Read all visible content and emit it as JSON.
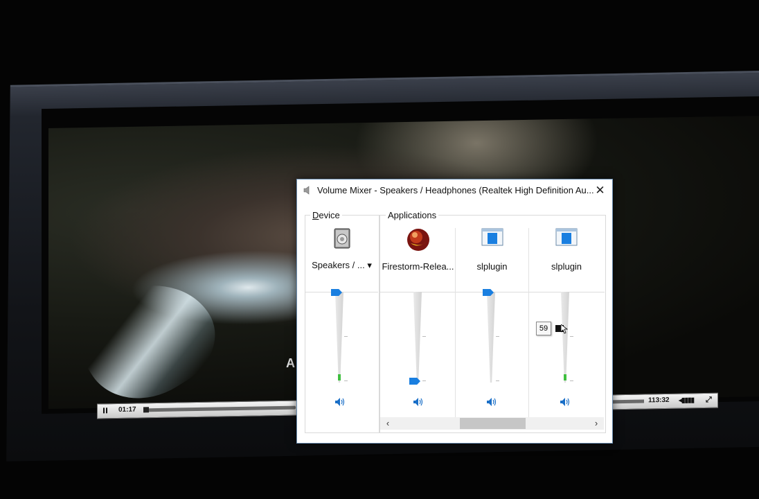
{
  "video_player": {
    "current_time": "01:17",
    "total_time": "113:32",
    "subtitle_fragment": "A",
    "progress": 0.011
  },
  "window": {
    "title": "Volume Mixer - Speakers / Headphones (Realtek High Definition Au...",
    "close_glyph": "✕",
    "title_icon": "speaker-icon"
  },
  "device": {
    "group_label_accel": "D",
    "group_label_rest": "evice",
    "name": "Speakers / ...",
    "dropdown_glyph": "▾",
    "icon": "speaker-device-icon",
    "volume": 100,
    "peak_level": 0.07,
    "mute_icon": "speaker-volume-icon"
  },
  "applications": {
    "group_label": "Applications",
    "items": [
      {
        "name": "Firestorm-Relea...",
        "icon": "firestorm-app-icon",
        "volume": 0,
        "peak_level": 0
      },
      {
        "name": "slplugin",
        "icon": "window-app-icon",
        "volume": 100,
        "peak_level": 0
      },
      {
        "name": "slplugin",
        "icon": "window-app-icon",
        "volume": 59,
        "peak_level": 0.07
      }
    ]
  },
  "tooltip": {
    "value": "59"
  },
  "scrollbar": {
    "left_glyph": "‹",
    "right_glyph": "›"
  },
  "colors": {
    "accent": "#1a7fe0",
    "level": "#3fbf3f",
    "window_border": "#6c8fb3"
  }
}
